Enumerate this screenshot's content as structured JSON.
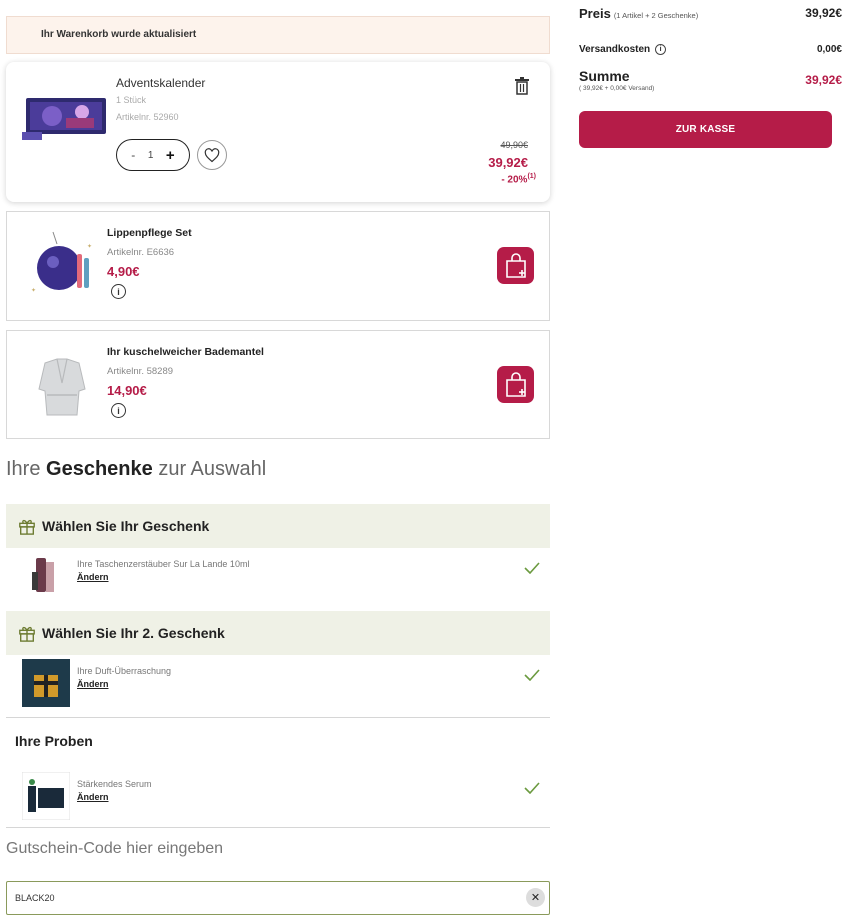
{
  "notice": {
    "text": "Ihr Warenkorb wurde aktualisiert"
  },
  "main_item": {
    "name": "Adventskalender",
    "quantity_label": "1 Stück",
    "sku": "Artikelnr. 52960",
    "quantity": "1",
    "minus": "-",
    "plus": "+",
    "old_price": "49,90€",
    "price": "39,92€",
    "discount": "- 20%",
    "discount_note": "(1)"
  },
  "gift_items": [
    {
      "name": "Lippenpflege Set",
      "sku": "Artikelnr. E6636",
      "price": "4,90€",
      "info": "i"
    },
    {
      "name": "Ihr kuschelweicher Bademantel",
      "sku": "Artikelnr. 58289",
      "price": "14,90€",
      "info": "i"
    }
  ],
  "gifts_section": {
    "title_pre": "Ihre ",
    "title_bold": "Geschenke",
    "title_post": " zur Auswahl"
  },
  "gift_choices": [
    {
      "heading": "Wählen Sie Ihr Geschenk",
      "label": "Ihre Taschenzerstäuber Sur La Lande 10ml",
      "change": "Ändern"
    },
    {
      "heading": "Wählen Sie Ihr 2. Geschenk",
      "label": "Ihre Duft-Überraschung",
      "change": "Ändern"
    }
  ],
  "samples": {
    "heading": "Ihre Proben",
    "label": "Stärkendes Serum",
    "change": "Ändern"
  },
  "voucher": {
    "label": "Gutschein-Code hier eingeben",
    "value": "BLACK20",
    "clear": "✕"
  },
  "summary": {
    "price_label": "Preis",
    "price_note": "(1 Artikel + 2 Geschenke)",
    "price_value": "39,92€",
    "shipping_label": "Versandkosten",
    "shipping_value": "0,00€",
    "total_label": "Summe",
    "total_note": "( 39,92€ + 0,00€ Versand)",
    "total_value": "39,92€",
    "checkout_label": "ZUR KASSE"
  },
  "colors": {
    "accent": "#b51c48",
    "gift_bg": "#eff1e6",
    "notice_bg": "#fdf3ec",
    "input_border": "#8a9a5b"
  }
}
